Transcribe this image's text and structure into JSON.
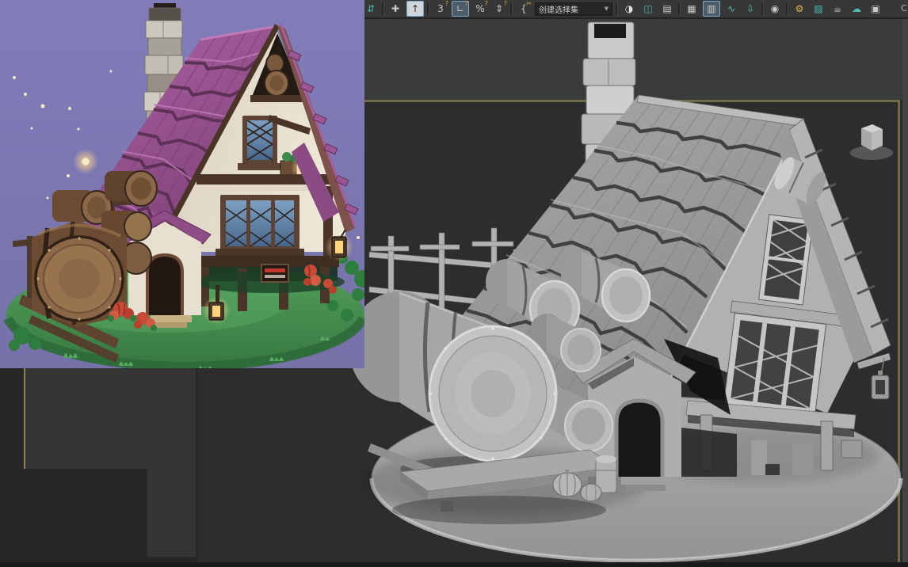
{
  "toolbar": {
    "background_color": "#373737",
    "items": [
      {
        "name": "window-crossing-toggle",
        "glyph": "⇵"
      },
      {
        "name": "select-and-move",
        "glyph": "✚"
      },
      {
        "name": "select-and-place",
        "glyph": "↑",
        "active": true
      },
      {
        "name": "snaps-toggle-3d",
        "glyph": "3",
        "badge": "?"
      },
      {
        "name": "angle-snap-toggle",
        "glyph": "∟",
        "badge": "?",
        "active": true
      },
      {
        "name": "percent-snap-toggle",
        "glyph": "%",
        "badge": "?"
      },
      {
        "name": "spinner-snap-toggle",
        "glyph": "⇕",
        "badge": "?"
      },
      {
        "name": "edit-named-selection-sets",
        "glyph": "{",
        "badge": "✂"
      },
      {
        "name": "mirror",
        "glyph": "◑"
      },
      {
        "name": "align",
        "glyph": "◫"
      },
      {
        "name": "toggle-scene-explorer",
        "glyph": "▤"
      },
      {
        "name": "toggle-layer-explorer",
        "glyph": "▦"
      },
      {
        "name": "toggle-ribbon",
        "glyph": "▥",
        "active": true
      },
      {
        "name": "curve-editor",
        "glyph": "∿"
      },
      {
        "name": "schematic-view",
        "glyph": "⇩"
      },
      {
        "name": "material-editor",
        "glyph": "◉"
      },
      {
        "name": "render-setup",
        "glyph": "⚙"
      },
      {
        "name": "rendered-frame-window",
        "glyph": "▧"
      },
      {
        "name": "render-production",
        "glyph": "☕"
      },
      {
        "name": "render-in-cloud",
        "glyph": "☁"
      },
      {
        "name": "render-gallery",
        "glyph": "▣"
      }
    ],
    "selection_set_dropdown": {
      "value": "创建选择集",
      "arrow": "▼"
    },
    "edge_partial_text": "C"
  },
  "viewport": {
    "background_color": "#2d2d2d",
    "active_border_color": "#8b8354",
    "top_band_color": "#3b3b3b",
    "model_style": "clay-gray",
    "viewcube_visible": true
  },
  "reference_image": {
    "background_color": "#7b77ae",
    "roof_color": "#9c5594",
    "wall_color": "#ece4d4",
    "timber_color": "#4a3428",
    "grass_color": "#4f9e58",
    "barrel_color": "#8a6848",
    "window_glass_color": "#6b90b4",
    "lantern_glow_color": "#ffd47c"
  }
}
